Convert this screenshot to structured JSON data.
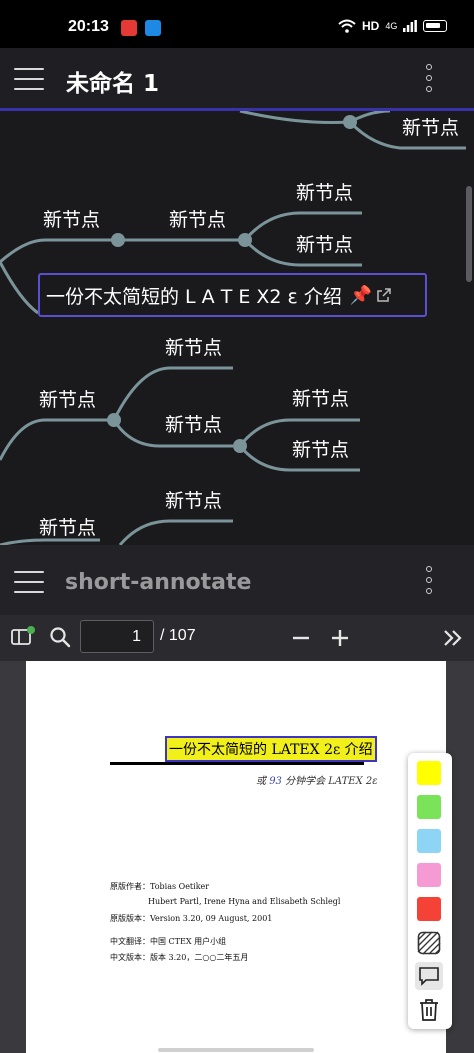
{
  "status_bar": {
    "time": "20:13",
    "network": "HD",
    "signal": "4G"
  },
  "top_bar": {
    "title": "未命名 1"
  },
  "mindmap": {
    "nodes": [
      "新节点",
      "新节点",
      "新节点",
      "新节点",
      "新节点",
      "新节点",
      "新节点",
      "新节点",
      "新节点",
      "新节点",
      "新节点",
      "新节点"
    ],
    "central_topic": "一份不太简短的 L A T E X2 ε 介绍",
    "central_icon": "pin-icon",
    "central_link_icon": "external-link-icon"
  },
  "pdf_bar": {
    "title": "short-annotate",
    "page_current": "1",
    "page_total": "/ 107"
  },
  "document": {
    "title": "一份不太简短的 LATEX 2ε 介绍",
    "subtitle_prefix": "或",
    "subtitle_num": "93",
    "subtitle_suffix": "分钟学会 LATEX 2ε",
    "meta": [
      {
        "label": "原版作者：",
        "value": "Tobias Oetiker"
      },
      {
        "label": "",
        "value": "Hubert Partl, Irene Hyna and Elisabeth Schlegl"
      },
      {
        "label": "原版版本：",
        "value": "Version 3.20, 09 August, 2001"
      },
      {
        "label": "中文翻译：",
        "value": "中国 CTEX 用户小组"
      },
      {
        "label": "中文版本：",
        "value": "版本 3.20，二○○二年五月"
      }
    ]
  },
  "palette": {
    "colors": [
      "#ffff00",
      "#7be35a",
      "#8dd4f5",
      "#f59ad2",
      "#f44336"
    ],
    "tools": [
      "hatch-icon",
      "comment-icon",
      "trash-icon"
    ]
  }
}
